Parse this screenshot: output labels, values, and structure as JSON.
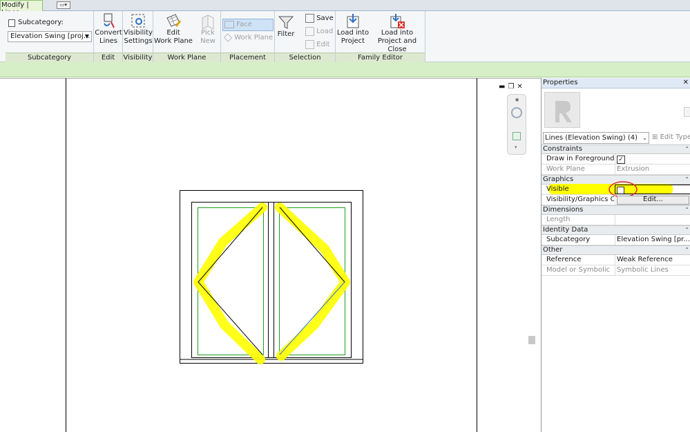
{
  "ribbon": {
    "active_tab": "Modify | Lines",
    "subcategory_label": "Subcategory:",
    "subcategory_value": "Elevation Swing [proj...",
    "panels": {
      "subcategory": "Subcategory",
      "edit": "Edit",
      "visibility": "Visibility",
      "work_plane": "Work Plane",
      "placement": "Placement",
      "selection": "Selection",
      "family_editor": "Family Editor"
    },
    "buttons": {
      "convert_lines": [
        "Convert",
        "Lines"
      ],
      "visibility_settings": [
        "Visibility",
        "Settings"
      ],
      "edit_work_plane": [
        "Edit",
        "Work Plane"
      ],
      "pick_new": [
        "Pick",
        "New"
      ],
      "face": "Face",
      "work_plane": "Work Plane",
      "filter": "Filter",
      "save": "Save",
      "load": "Load",
      "edit": "Edit",
      "load_into_project": [
        "Load into",
        "Project"
      ],
      "load_into_project_close": [
        "Load into",
        "Project and Close"
      ]
    }
  },
  "properties": {
    "title": "Properties",
    "type_selector": "Lines (Elevation Swing) (4)",
    "edit_type": "Edit Type",
    "groups": {
      "constraints": "Constraints",
      "graphics": "Graphics",
      "dimensions": "Dimensions",
      "identity_data": "Identity Data",
      "other": "Other"
    },
    "rows": {
      "draw_in_foreground": {
        "label": "Draw in Foreground",
        "value": true
      },
      "work_plane": {
        "label": "Work Plane",
        "value": "Extrusion"
      },
      "visible": {
        "label": "Visible",
        "value": false
      },
      "vg_overrides": {
        "label": "Visibility/Graphics O...",
        "value": "Edit..."
      },
      "length": {
        "label": "Length",
        "value": ""
      },
      "subcategory": {
        "label": "Subcategory",
        "value": "Elevation Swing [pr..."
      },
      "reference": {
        "label": "Reference",
        "value": "Weak Reference"
      },
      "model_or_symbolic": {
        "label": "Model or Symbolic",
        "value": "Symbolic Lines"
      }
    }
  },
  "colors": {
    "highlight": "#ffff00",
    "annotation_circle": "#e0202a",
    "frame_green": "#2ea32e",
    "swing_blue": "#2f6fd6"
  },
  "icons": [
    "convert-lines-icon",
    "visibility-settings-icon",
    "edit-work-plane-icon",
    "pick-new-icon",
    "filter-icon",
    "load-into-project-icon",
    "load-into-project-close-icon",
    "close-icon",
    "restore-icon",
    "steering-wheel-icon",
    "zoom-icon"
  ]
}
